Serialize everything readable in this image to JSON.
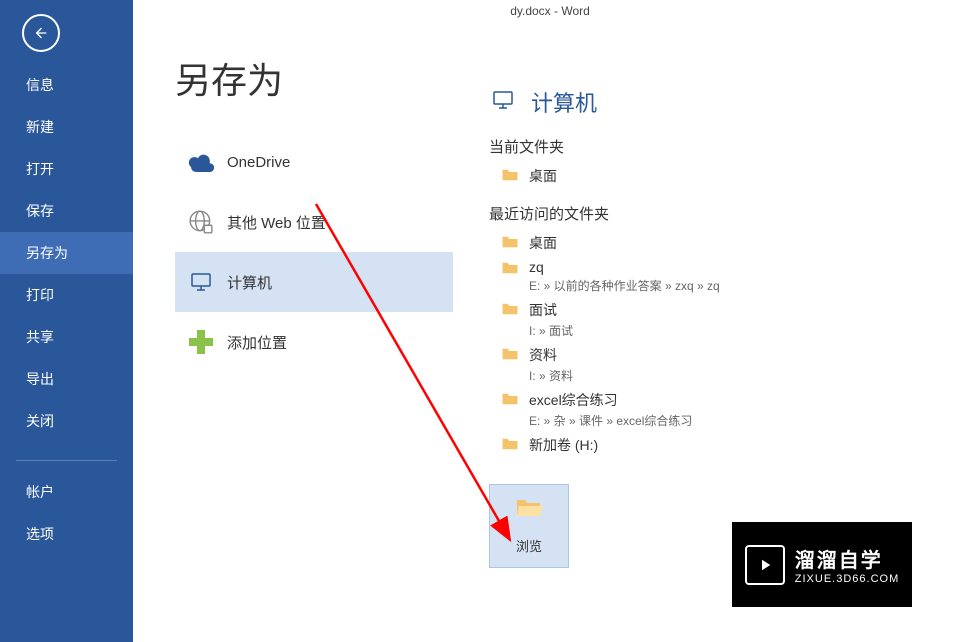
{
  "title_bar": "dy.docx - Word",
  "page_title": "另存为",
  "sidebar": {
    "items": [
      {
        "label": "信息"
      },
      {
        "label": "新建"
      },
      {
        "label": "打开"
      },
      {
        "label": "保存"
      },
      {
        "label": "另存为"
      },
      {
        "label": "打印"
      },
      {
        "label": "共享"
      },
      {
        "label": "导出"
      },
      {
        "label": "关闭"
      }
    ],
    "bottom": [
      {
        "label": "帐户"
      },
      {
        "label": "选项"
      }
    ]
  },
  "locations": {
    "onedrive": "OneDrive",
    "web": "其他 Web 位置",
    "computer": "计算机",
    "add": "添加位置"
  },
  "right": {
    "header": "计算机",
    "current_section": "当前文件夹",
    "current": {
      "name": "桌面"
    },
    "recent_section": "最近访问的文件夹",
    "recent": [
      {
        "name": "桌面",
        "path": ""
      },
      {
        "name": "zq",
        "path": "E: » 以前的各种作业答案 » zxq » zq"
      },
      {
        "name": "面试",
        "path": "I: » 面试"
      },
      {
        "name": "资料",
        "path": "I: » 资料"
      },
      {
        "name": "excel综合练习",
        "path": "E: » 杂 » 课件 » excel综合练习"
      },
      {
        "name": "新加卷 (H:)",
        "path": ""
      }
    ],
    "browse": "浏览"
  },
  "watermark": {
    "line1": "溜溜自学",
    "line2": "ZIXUE.3D66.COM"
  }
}
